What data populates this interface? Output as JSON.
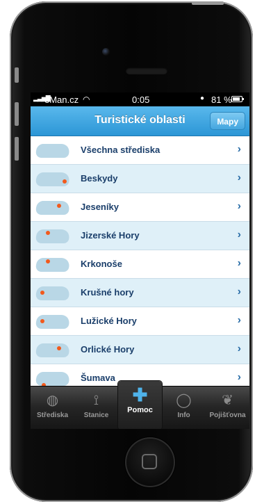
{
  "status": {
    "carrier": "eMan.cz",
    "time": "0:05",
    "battery": "81 %",
    "battery_level": 0.81
  },
  "navbar": {
    "title": "Turistické oblasti",
    "button": "Mapy"
  },
  "list": [
    {
      "label": "Všechna střediska",
      "marker": "none"
    },
    {
      "label": "Beskydy",
      "marker": "east"
    },
    {
      "label": "Jeseníky",
      "marker": "north-east"
    },
    {
      "label": "Jizerské Hory",
      "marker": "north"
    },
    {
      "label": "Krkonoše",
      "marker": "north"
    },
    {
      "label": "Krušné hory",
      "marker": "north-west"
    },
    {
      "label": "Lužické Hory",
      "marker": "north-west"
    },
    {
      "label": "Orlické Hory",
      "marker": "north-east"
    },
    {
      "label": "Šumava",
      "marker": "south-west"
    }
  ],
  "tabs": [
    {
      "label": "Střediska",
      "icon": "globe-icon"
    },
    {
      "label": "Stanice",
      "icon": "antenna-icon"
    },
    {
      "label": "Pomoc",
      "icon": "plus-icon",
      "active": true
    },
    {
      "label": "Info",
      "icon": "speech-bubble-icon"
    },
    {
      "label": "Pojišťovna",
      "icon": "leaf-icon"
    }
  ],
  "colors": {
    "navbar": "#2c96d6",
    "row_alt": "#dff0f8",
    "text": "#1a3e6a",
    "marker": "#f25a1d",
    "accent": "#4fb3ea"
  }
}
